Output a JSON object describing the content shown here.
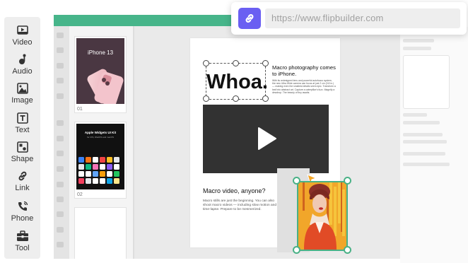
{
  "toolbar": {
    "items": [
      {
        "label": "Video",
        "icon": "video-icon"
      },
      {
        "label": "Audio",
        "icon": "audio-icon"
      },
      {
        "label": "Image",
        "icon": "image-icon"
      },
      {
        "label": "Text",
        "icon": "text-icon"
      },
      {
        "label": "Shape",
        "icon": "shape-icon"
      },
      {
        "label": "Link",
        "icon": "link-icon"
      },
      {
        "label": "Phone",
        "icon": "phone-icon"
      },
      {
        "label": "Tool",
        "icon": "tool-icon"
      }
    ]
  },
  "thumbnails": [
    {
      "number": "01",
      "caption": "iPhone 13"
    },
    {
      "number": "02",
      "caption": "Apple Widgets UI Kit",
      "subcaption": "for iOS, iPadOS and macOS"
    }
  ],
  "url_popup": {
    "url": "https://www.flipbuilder.com",
    "icon": "link-icon",
    "accent": "#6a5ff2"
  },
  "page": {
    "headline": "Whoa.",
    "macro_title": "Macro photography comes to iPhone.",
    "macro_body": "With its redesigned lens and powerful autofocus system, the new Ultra Wide camera can focus at just 2 cm (0.8 in.) — making even the smallest details seem epic. Transform a leaf into abstract art. Capture a caterpillar's fuzz. Magnify a dewdrop. The beauty of tiny awaits.",
    "video_icon": "play-icon",
    "section_title": "Macro video, anyone?",
    "section_body": "Macro stills are just the beginning. You can also shoot macro videos — including slow motion and time-lapse. Prepare to be mesmerized."
  },
  "colors": {
    "brand_green": "#47b58a",
    "selection_green": "#49b186"
  }
}
